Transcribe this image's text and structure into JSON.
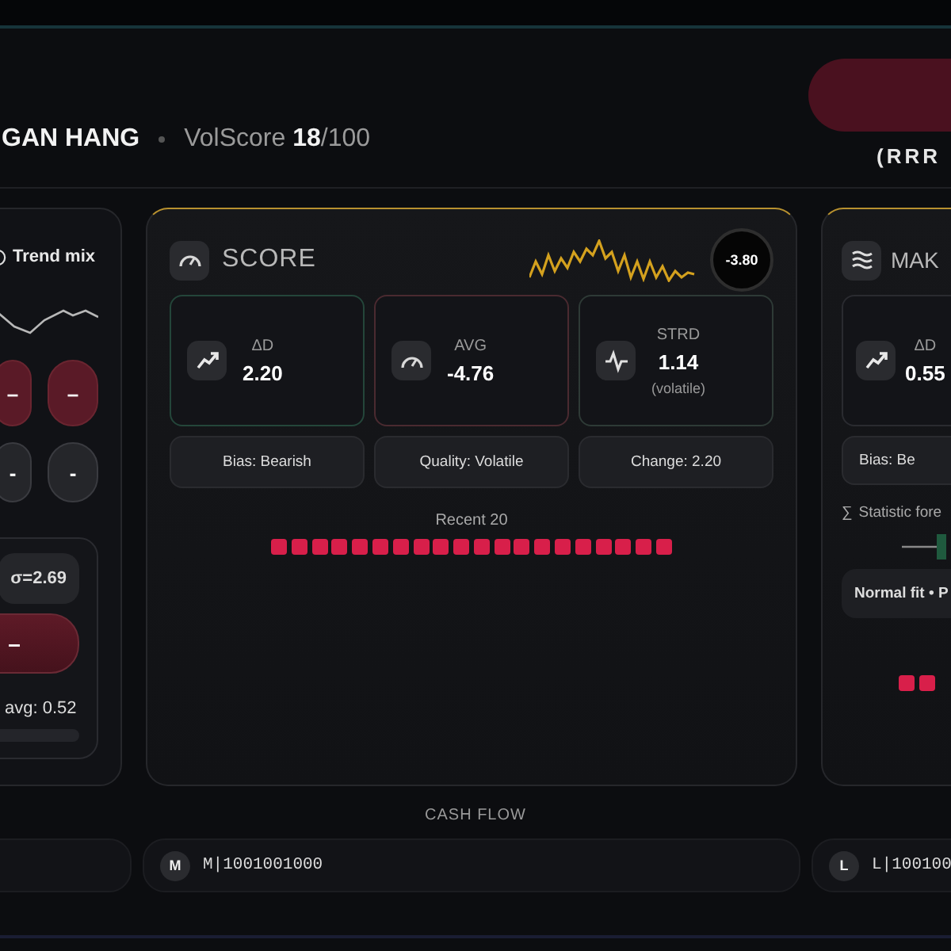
{
  "header": {
    "title": "GAN HANG",
    "score_label": "VolScore",
    "score": "18",
    "score_total": "/100",
    "action_caption": "(RRR"
  },
  "trend_panel": {
    "title": "Trend mix",
    "pills": [
      {
        "label": "–",
        "kind": "red"
      },
      {
        "label": "–",
        "kind": "red"
      },
      {
        "label": "-",
        "kind": "grey"
      },
      {
        "label": "-",
        "kind": "grey"
      }
    ],
    "sigma": "σ=2.69",
    "main_pill": "–",
    "avg": "avg: 0.52"
  },
  "score_panel": {
    "title": "SCORE",
    "badge": "-3.80",
    "metrics": [
      {
        "kind": "trend",
        "label": "ΔD",
        "value": "2.20",
        "color": "#24463a"
      },
      {
        "kind": "gauge",
        "label": "AVG",
        "value": "-4.76",
        "color": "#4a2a30"
      },
      {
        "kind": "pulse",
        "label": "STRD",
        "value": "1.14",
        "note": "(volatile)",
        "color": "#2e3a36"
      }
    ],
    "chips": [
      "Bias: Bearish",
      "Quality: Volatile",
      "Change: 2.20"
    ],
    "recent_label": "Recent 20",
    "recent": [
      {
        "color": "#d81f4a"
      },
      {
        "color": "#d81f4a"
      },
      {
        "color": "#d81f4a"
      },
      {
        "color": "#d81f4a"
      },
      {
        "color": "#d81f4a"
      },
      {
        "color": "#d81f4a"
      },
      {
        "color": "#d81f4a"
      },
      {
        "color": "#d81f4a"
      },
      {
        "color": "#d81f4a"
      },
      {
        "color": "#d81f4a"
      },
      {
        "color": "#d81f4a"
      },
      {
        "color": "#d81f4a"
      },
      {
        "color": "#d81f4a"
      },
      {
        "color": "#d81f4a"
      },
      {
        "color": "#d81f4a"
      },
      {
        "color": "#d81f4a"
      },
      {
        "color": "#d81f4a"
      },
      {
        "color": "#d81f4a"
      },
      {
        "color": "#d81f4a"
      },
      {
        "color": "#d81f4a"
      }
    ]
  },
  "make_panel": {
    "title": "MAK",
    "metric": {
      "kind": "trend",
      "label": "ΔD",
      "value": "0.55"
    },
    "chip": "Bias: Be",
    "stat_icon": "∑",
    "stat_label": "Statistic fore",
    "fit": "Normal fit • P",
    "recent": [
      {
        "color": "#d81f4a"
      },
      {
        "color": "#d81f4a"
      }
    ]
  },
  "cash_flow": {
    "title": "CASH FLOW",
    "rows": [
      {},
      {
        "badge": "M",
        "code": "M|1001001000"
      },
      {
        "badge": "L",
        "code": "L|100100"
      }
    ]
  }
}
